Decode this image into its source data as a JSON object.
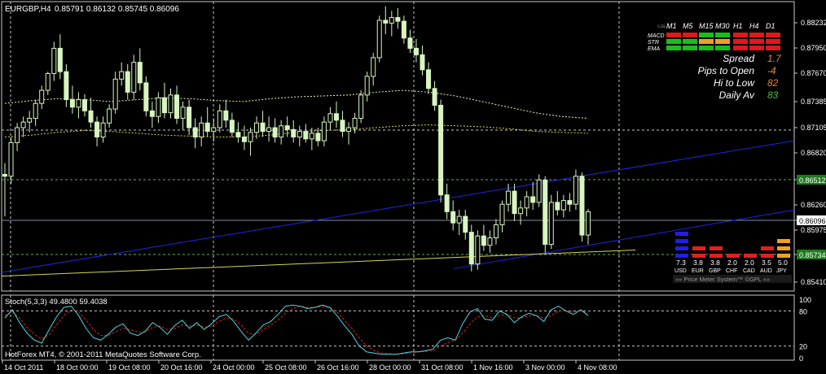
{
  "header": {
    "symbol": "EURGBP,H4",
    "ohlc": "0.85791 0.86132 0.85745 0.86096"
  },
  "colors": {
    "background": "#000000",
    "bull_candle": "#d8f5c0",
    "bear_candle": "#d8f5c0",
    "wick": "#d8f5c0",
    "grid": "#c8c8c8",
    "channel": "#2323e6",
    "support": "#d8d84a",
    "bollinger": "#f0f0b0",
    "stoch_main": "#4ad7e0",
    "stoch_signal": "#e02020",
    "hline": "#5ab25a",
    "bid_line": "#8090a0"
  },
  "price_axis": {
    "labels": [
      "0.88232",
      "0.87950",
      "0.87670",
      "0.87385",
      "0.87105",
      "0.86820",
      "0.86512",
      "0.86260",
      "0.86096",
      "0.85975",
      "0.85734",
      "0.85410"
    ],
    "highlight_current": "0.86096",
    "highlight_green": [
      "0.86512",
      "0.85734"
    ]
  },
  "time_axis": {
    "labels": [
      "14 Oct 2011",
      "18 Oct 00:00",
      "19 Oct 08:00",
      "20 Oct 16:00",
      "24 Oct 00:00",
      "25 Oct 08:00",
      "26 Oct 16:00",
      "28 Oct 00:00",
      "31 Oct 08:00",
      "1 Nov 16:00",
      "3 Nov 00:00",
      "4 Nov 08:00"
    ]
  },
  "indicator_panel": {
    "title": "Stoch(5,3,3) 49.4800 59.4038",
    "levels": [
      "100",
      "80",
      "20",
      "0"
    ]
  },
  "footer_text": "HotForex MT4, © 2001-2011 MetaQuotes Software Corp.",
  "dashboard": {
    "tiny_label": "cJa",
    "timeframes": [
      "M1",
      "M5",
      "M15",
      "M30",
      "H1",
      "H4",
      "D1"
    ],
    "rows": [
      {
        "name": "MACD",
        "cells": [
          "red",
          "red",
          "green",
          "green",
          "red",
          "red",
          "red"
        ]
      },
      {
        "name": "STR",
        "cells": [
          "green",
          "green",
          "orange",
          "orange",
          "red",
          "red",
          "red"
        ]
      },
      {
        "name": "EMA",
        "cells": [
          "green",
          "green",
          "green",
          "green",
          "red",
          "red",
          "red"
        ]
      }
    ],
    "stats": [
      {
        "label": "Spread",
        "value": "1.7",
        "color": "#e8862a"
      },
      {
        "label": "Pips to Open",
        "value": "-4",
        "color": "#e8862a"
      },
      {
        "label": "Hi to Low",
        "value": "82",
        "color": "#e8862a"
      },
      {
        "label": "Daily Av",
        "value": "83",
        "color": "#3cc83c"
      }
    ]
  },
  "price_meter": {
    "currencies": [
      "USD",
      "EUR",
      "GBP",
      "CHF",
      "CAD",
      "AUD",
      "JPY"
    ],
    "values": [
      "7.3",
      "3.8",
      "3.8",
      "2.0",
      "2.0",
      "3.5",
      "5.0"
    ],
    "caption": "»» Price Meter System™ ©GPL ««"
  },
  "chart_data": {
    "type": "candlestick",
    "symbol": "EURGBP",
    "timeframe": "H4",
    "ylim": [
      0.8525,
      0.8835
    ],
    "indicator_ylim": [
      0,
      100
    ],
    "candles": [
      [
        0.865,
        0.8662,
        0.8605,
        0.8648
      ],
      [
        0.8648,
        0.869,
        0.864,
        0.8684
      ],
      [
        0.8684,
        0.8705,
        0.8675,
        0.87
      ],
      [
        0.87,
        0.8712,
        0.869,
        0.8706
      ],
      [
        0.8706,
        0.8718,
        0.8695,
        0.871
      ],
      [
        0.871,
        0.873,
        0.8702,
        0.8726
      ],
      [
        0.8726,
        0.8745,
        0.872,
        0.874
      ],
      [
        0.874,
        0.876,
        0.8735,
        0.8758
      ],
      [
        0.8758,
        0.8792,
        0.875,
        0.8785
      ],
      [
        0.8785,
        0.88,
        0.8752,
        0.876
      ],
      [
        0.876,
        0.8768,
        0.8722,
        0.873
      ],
      [
        0.873,
        0.8745,
        0.8715,
        0.8722
      ],
      [
        0.8722,
        0.8738,
        0.871,
        0.873
      ],
      [
        0.873,
        0.8736,
        0.8712,
        0.8718
      ],
      [
        0.8718,
        0.8732,
        0.87,
        0.8706
      ],
      [
        0.8706,
        0.8712,
        0.868,
        0.869
      ],
      [
        0.869,
        0.8712,
        0.8684,
        0.8705
      ],
      [
        0.8705,
        0.8725,
        0.87,
        0.872
      ],
      [
        0.872,
        0.876,
        0.8715,
        0.8752
      ],
      [
        0.8752,
        0.877,
        0.8745,
        0.876
      ],
      [
        0.876,
        0.8768,
        0.873,
        0.8738
      ],
      [
        0.8738,
        0.8778,
        0.873,
        0.877
      ],
      [
        0.877,
        0.8785,
        0.874,
        0.8748
      ],
      [
        0.8748,
        0.8755,
        0.8712,
        0.8718
      ],
      [
        0.8718,
        0.8728,
        0.87,
        0.8712
      ],
      [
        0.8712,
        0.8738,
        0.8705,
        0.8732
      ],
      [
        0.8732,
        0.8748,
        0.871,
        0.8716
      ],
      [
        0.8716,
        0.8742,
        0.871,
        0.8735
      ],
      [
        0.8735,
        0.8745,
        0.8704,
        0.871
      ],
      [
        0.871,
        0.8728,
        0.8698,
        0.8722
      ],
      [
        0.8722,
        0.873,
        0.8692,
        0.87
      ],
      [
        0.87,
        0.871,
        0.8678,
        0.869
      ],
      [
        0.869,
        0.8712,
        0.868,
        0.8705
      ],
      [
        0.8705,
        0.8722,
        0.869,
        0.8696
      ],
      [
        0.8696,
        0.871,
        0.8685,
        0.87
      ],
      [
        0.87,
        0.8725,
        0.8695,
        0.8718
      ],
      [
        0.8718,
        0.873,
        0.87,
        0.8708
      ],
      [
        0.8708,
        0.8716,
        0.869,
        0.8695
      ],
      [
        0.8695,
        0.8706,
        0.8684,
        0.869
      ],
      [
        0.869,
        0.8702,
        0.8676,
        0.8685
      ],
      [
        0.8685,
        0.87,
        0.867,
        0.8695
      ],
      [
        0.8695,
        0.8712,
        0.8688,
        0.8705
      ],
      [
        0.8705,
        0.8718,
        0.869,
        0.8696
      ],
      [
        0.8696,
        0.8712,
        0.8685,
        0.87
      ],
      [
        0.87,
        0.871,
        0.8684,
        0.869
      ],
      [
        0.869,
        0.8708,
        0.8682,
        0.8702
      ],
      [
        0.8702,
        0.8712,
        0.869,
        0.8698
      ],
      [
        0.8698,
        0.8708,
        0.8684,
        0.869
      ],
      [
        0.869,
        0.8702,
        0.868,
        0.8696
      ],
      [
        0.8696,
        0.8704,
        0.8684,
        0.8688
      ],
      [
        0.8688,
        0.87,
        0.8676,
        0.8694
      ],
      [
        0.8694,
        0.87,
        0.868,
        0.8686
      ],
      [
        0.8686,
        0.8712,
        0.868,
        0.8706
      ],
      [
        0.8706,
        0.8722,
        0.8698,
        0.8715
      ],
      [
        0.8715,
        0.8728,
        0.87,
        0.8708
      ],
      [
        0.8708,
        0.8718,
        0.869,
        0.8696
      ],
      [
        0.8696,
        0.8706,
        0.8682,
        0.87
      ],
      [
        0.87,
        0.8716,
        0.8694,
        0.871
      ],
      [
        0.871,
        0.874,
        0.8705,
        0.8735
      ],
      [
        0.8735,
        0.876,
        0.8728,
        0.8755
      ],
      [
        0.8755,
        0.878,
        0.8745,
        0.8775
      ],
      [
        0.8775,
        0.882,
        0.877,
        0.8815
      ],
      [
        0.8815,
        0.883,
        0.88,
        0.8812
      ],
      [
        0.8812,
        0.8825,
        0.8798,
        0.8818
      ],
      [
        0.8818,
        0.8828,
        0.8806,
        0.8814
      ],
      [
        0.8814,
        0.882,
        0.879,
        0.8796
      ],
      [
        0.8796,
        0.8805,
        0.878,
        0.8785
      ],
      [
        0.8785,
        0.8795,
        0.877,
        0.8778
      ],
      [
        0.8778,
        0.8788,
        0.8756,
        0.8762
      ],
      [
        0.8762,
        0.877,
        0.8736,
        0.8742
      ],
      [
        0.8742,
        0.875,
        0.8718,
        0.8724
      ],
      [
        0.8724,
        0.873,
        0.862,
        0.8628
      ],
      [
        0.8628,
        0.864,
        0.8602,
        0.861
      ],
      [
        0.861,
        0.8622,
        0.859,
        0.8598
      ],
      [
        0.8598,
        0.8612,
        0.8585,
        0.8605
      ],
      [
        0.8605,
        0.8612,
        0.858,
        0.8588
      ],
      [
        0.8588,
        0.8596,
        0.8546,
        0.8554
      ],
      [
        0.8554,
        0.859,
        0.8548,
        0.8584
      ],
      [
        0.8584,
        0.8596,
        0.8568,
        0.8574
      ],
      [
        0.8574,
        0.859,
        0.8566,
        0.8582
      ],
      [
        0.8582,
        0.8602,
        0.8575,
        0.8596
      ],
      [
        0.8596,
        0.8622,
        0.8588,
        0.8618
      ],
      [
        0.8618,
        0.864,
        0.861,
        0.8632
      ],
      [
        0.8632,
        0.864,
        0.86,
        0.8608
      ],
      [
        0.8608,
        0.8622,
        0.8596,
        0.8614
      ],
      [
        0.8614,
        0.8632,
        0.8605,
        0.8626
      ],
      [
        0.8626,
        0.8642,
        0.8612,
        0.862
      ],
      [
        0.862,
        0.865,
        0.8615,
        0.8644
      ],
      [
        0.8644,
        0.8648,
        0.8566,
        0.8575
      ],
      [
        0.8575,
        0.8628,
        0.857,
        0.862
      ],
      [
        0.862,
        0.8632,
        0.8606,
        0.8612
      ],
      [
        0.8612,
        0.8628,
        0.8604,
        0.8622
      ],
      [
        0.8622,
        0.863,
        0.861,
        0.8618
      ],
      [
        0.8618,
        0.8655,
        0.8612,
        0.8648
      ],
      [
        0.8648,
        0.8652,
        0.8578,
        0.8585
      ],
      [
        0.8585,
        0.8613,
        0.8575,
        0.861
      ]
    ],
    "channel_upper": [
      [
        0,
        0.8545
      ],
      [
        1,
        0.8686
      ]
    ],
    "channel_lower": [
      [
        0.57,
        0.8549
      ],
      [
        1,
        0.8612
      ]
    ],
    "support_line": [
      [
        0,
        0.8541
      ],
      [
        0.8,
        0.8569
      ]
    ],
    "bollinger_upper": [
      0.8726,
      0.8729,
      0.8731,
      0.873,
      0.8728,
      0.873,
      0.8732,
      0.8731,
      0.8729,
      0.8728,
      0.8731,
      0.8733,
      0.8734,
      0.8735,
      0.8738,
      0.874,
      0.8738,
      0.8734,
      0.8728,
      0.8722,
      0.8716,
      0.8712,
      0.871
    ],
    "bollinger_lower": [
      0.869,
      0.8692,
      0.8695,
      0.8697,
      0.8696,
      0.8694,
      0.8692,
      0.8691,
      0.869,
      0.869,
      0.8692,
      0.8695,
      0.8697,
      0.8698,
      0.87,
      0.8702,
      0.8703,
      0.8702,
      0.8701,
      0.8699,
      0.8696,
      0.8695,
      0.8694
    ],
    "stoch_main": [
      68,
      82,
      60,
      42,
      30,
      25,
      48,
      70,
      86,
      88,
      72,
      50,
      34,
      30,
      40,
      52,
      58,
      42,
      38,
      45,
      60,
      52,
      40,
      55,
      64,
      50,
      60,
      48,
      58,
      70,
      74,
      62,
      45,
      30,
      42,
      56,
      62,
      74,
      88,
      90,
      88,
      84,
      86,
      90,
      86,
      72,
      55,
      40,
      20,
      10,
      8,
      6,
      6,
      6,
      8,
      10,
      10,
      12,
      15,
      30,
      34,
      30,
      58,
      78,
      84,
      66,
      64,
      80,
      74,
      60,
      70,
      76,
      72,
      62,
      82,
      88,
      80,
      74,
      82,
      72
    ],
    "stoch_signal": [
      72,
      78,
      68,
      52,
      40,
      32,
      40,
      56,
      72,
      82,
      78,
      64,
      48,
      38,
      38,
      44,
      50,
      48,
      44,
      44,
      52,
      54,
      48,
      50,
      56,
      54,
      56,
      52,
      54,
      62,
      68,
      66,
      56,
      42,
      40,
      48,
      56,
      64,
      76,
      84,
      88,
      86,
      86,
      88,
      86,
      78,
      64,
      50,
      34,
      20,
      12,
      8,
      7,
      6,
      7,
      8,
      10,
      11,
      12,
      20,
      26,
      30,
      42,
      58,
      70,
      72,
      68,
      72,
      74,
      68,
      68,
      72,
      72,
      68,
      72,
      80,
      80,
      78,
      80,
      76
    ]
  }
}
